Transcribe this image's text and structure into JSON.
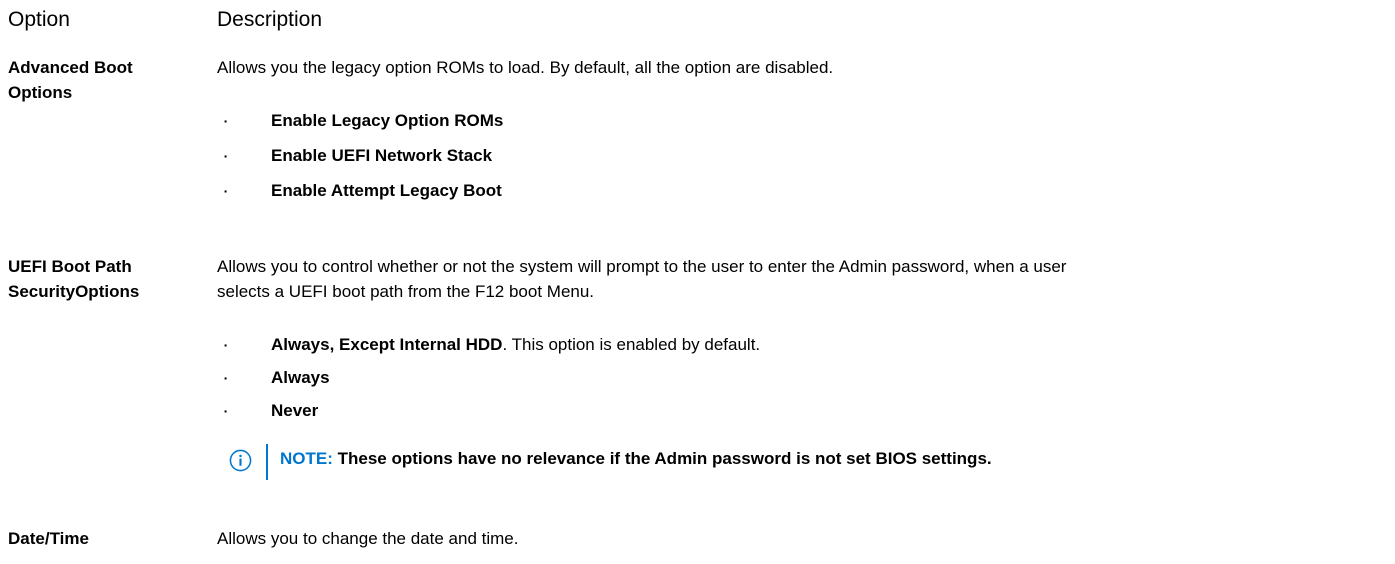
{
  "headers": {
    "option": "Option",
    "description": "Description"
  },
  "rows": [
    {
      "option_line1": "Advanced Boot",
      "option_line2": "Options",
      "description": "Allows you the legacy option ROMs to load. By default, all the option are disabled.",
      "bullets": [
        {
          "strong": "Enable Legacy Option ROMs",
          "rest": ""
        },
        {
          "strong": "Enable UEFI Network Stack",
          "rest": ""
        },
        {
          "strong": "Enable Attempt Legacy Boot",
          "rest": ""
        }
      ]
    },
    {
      "option_line1": "UEFI Boot Path",
      "option_line2": "SecurityOptions",
      "description_line1": "Allows you to control whether or not the system will prompt to the user to enter the Admin password, when a user",
      "description_line2": "selects a UEFI boot path from the F12 boot Menu.",
      "bullets": [
        {
          "strong": "Always, Except Internal HDD",
          "rest": ". This option is enabled by default."
        },
        {
          "strong": "Always",
          "rest": ""
        },
        {
          "strong": "Never",
          "rest": ""
        }
      ],
      "note": {
        "label": "NOTE:",
        "text": " These options have no relevance if the Admin password is not set BIOS settings."
      }
    },
    {
      "option_line1": "Date/Time",
      "description": "Allows you to change the date and time."
    }
  ],
  "colors": {
    "note_accent": "#0076ce",
    "text": "#000000"
  },
  "icons": {
    "note_icon": "info-circle-icon",
    "bullet": "bullet-dot"
  }
}
